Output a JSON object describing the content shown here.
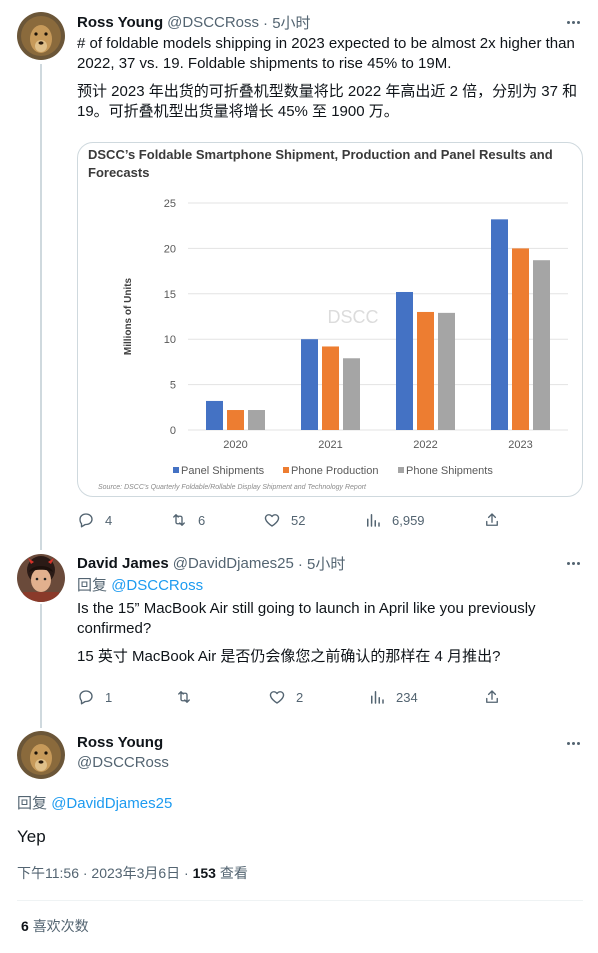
{
  "tweet1": {
    "name": "Ross Young",
    "handle": "@DSCCRoss",
    "time": "· 5小时",
    "text_en": "# of foldable models shipping in 2023 expected to be almost 2x higher than 2022, 37 vs. 19. Foldable shipments to rise 45% to 19M.",
    "text_zh": "预计 2023 年出货的可折叠机型数量将比 2022 年高出近 2 倍，分别为 37 和 19。可折叠机型出货量将增长 45% 至 1900 万。",
    "stats": {
      "replies": "4",
      "retweets": "6",
      "likes": "52",
      "views": "6,959"
    }
  },
  "tweet2": {
    "name": "David James",
    "handle": "@DavidDjames25",
    "time": "· 5小时",
    "reply_prefix": "回复",
    "reply_to": "@DSCCRoss",
    "text_en": "Is the 15” MacBook Air still going to launch in April like you previously confirmed?",
    "text_zh": "15 英寸 MacBook Air 是否仍会像您之前确认的那样在 4 月推出?",
    "stats": {
      "replies": "1",
      "retweets": "",
      "likes": "2",
      "views": "234"
    }
  },
  "tweet3": {
    "name": "Ross Young",
    "handle": "@DSCCRoss",
    "reply_prefix": "回复",
    "reply_to": "@DavidDjames25",
    "text": "Yep",
    "timestamp": "下午11:56 · 2023年3月6日 ·",
    "views_count": "153",
    "views_label": "查看",
    "likes_count": "6",
    "likes_label": "喜欢次数"
  },
  "chart_data": {
    "type": "bar",
    "title": "DSCC’s Foldable Smartphone Shipment, Production and Panel Results and Forecasts",
    "ylabel": "Millions of Units",
    "xlabel": "",
    "ylim": [
      0,
      25
    ],
    "yticks": [
      0,
      5,
      10,
      15,
      20,
      25
    ],
    "categories": [
      "2020",
      "2021",
      "2022",
      "2023"
    ],
    "series": [
      {
        "name": "Panel Shipments",
        "color": "#4472c4",
        "values": [
          3.2,
          10.0,
          15.2,
          23.2
        ]
      },
      {
        "name": "Phone Production",
        "color": "#ed7d31",
        "values": [
          2.2,
          9.2,
          13.0,
          20.0
        ]
      },
      {
        "name": "Phone Shipments",
        "color": "#a5a5a5",
        "values": [
          2.2,
          7.9,
          12.9,
          18.7
        ]
      }
    ],
    "watermark": "DSCC",
    "source": "Source: DSCC's Quarterly Foldable/Rollable Display Shipment and Technology Report",
    "legend_position": "bottom",
    "grid": true
  }
}
